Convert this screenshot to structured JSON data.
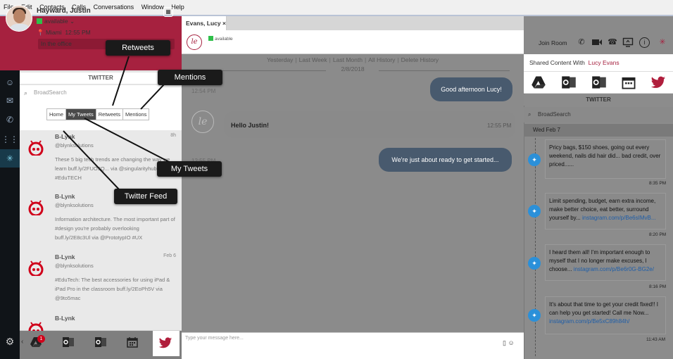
{
  "menu": [
    "File",
    "Edit",
    "Contacts",
    "Calls",
    "Conversations",
    "Window",
    "Help"
  ],
  "profile": {
    "name": "Hayward, Justin",
    "status": "available",
    "location": "Miami",
    "time": "12:55 PM",
    "note": "In the office"
  },
  "twitter_panel": {
    "title": "TWITTER",
    "search_placeholder": "BroadSearch",
    "tabs": [
      "Home",
      "My Tweets",
      "Retweets",
      "Mentions"
    ],
    "selected_tab": "My Tweets",
    "tweets": [
      {
        "name": "B-Lynk",
        "handle": "@blynksolutions",
        "date": "8h",
        "text": "These 5 big tech trends are changing the way we learn buff.ly/2FUO3Q... via @singularityhub #EduTECH"
      },
      {
        "name": "B-Lynk",
        "handle": "@blynksolutions",
        "date": "",
        "text": "Information architecture. The most important part of #design you're probably overlooking buff.ly/2E8c3Ul via @PrototypIO #UX"
      },
      {
        "name": "B-Lynk",
        "handle": "@blynksolutions",
        "date": "Feb 6",
        "text": "#EduTech: The best accessories for using iPad & iPad Pro in the classroom buff.ly/2EoPh5V via @9to5mac"
      },
      {
        "name": "B-Lynk",
        "handle": "",
        "date": "",
        "text": ""
      }
    ]
  },
  "bottom_bar": {
    "badge_count": "1"
  },
  "chat": {
    "tab_title": "Evans, Lucy",
    "tab_close": "×",
    "contact_initials": "le",
    "contact_status": "available",
    "filters": [
      "Yesterday",
      "Last Week",
      "Last Month",
      "All History",
      "Delete History"
    ],
    "date": "2/8/2018",
    "messages": [
      {
        "text": "Good afternoon Lucy!",
        "time": "12:54 PM",
        "from": "me"
      },
      {
        "text": "Hello Justin!",
        "time": "12:55 PM",
        "from": "them"
      },
      {
        "text": "We're just about ready to get started...",
        "time": "12:55 PM",
        "from": "me"
      }
    ],
    "input_placeholder": "Type your message here..."
  },
  "toolbar": {
    "join_room": "Join Room"
  },
  "right_panel": {
    "shared_label": "Shared Content With",
    "shared_with": "Lucy Evans",
    "twitter_title": "TWITTER",
    "search_placeholder": "BroadSearch",
    "date_header": "Wed Feb 7",
    "cards": [
      {
        "text": "Pricy bags, $150 shoes, going out every weekend, nails did hair did... bad credit, over priced......",
        "link": "",
        "time": "8:35 PM"
      },
      {
        "text": "Limit spending, budget, earn extra income, make better choice, eat better, surround yourself by...",
        "link": "instagram.com/p/Be6sIMvB...",
        "time": "8:20 PM"
      },
      {
        "text": "I heard them all! I'm important enough to myself that I no longer make excuses, I choose...",
        "link": "instagram.com/p/Be6r0G-BG2e/",
        "time": "8:16 PM"
      },
      {
        "text": "It's about that time to get your credit fixed!! I can help you get started! Call me Now...",
        "link": "instagram.com/p/Be5xC89h84h/",
        "time": "11:43 AM"
      }
    ]
  },
  "callouts": {
    "retweets": "Retweets",
    "mentions": "Mentions",
    "my_tweets": "My Tweets",
    "twitter_feed": "Twitter Feed"
  },
  "colors": {
    "brand": "#a6213f",
    "bubble": "#485a6e",
    "twitter": "#2b90d9",
    "available": "#2fbf4a"
  }
}
